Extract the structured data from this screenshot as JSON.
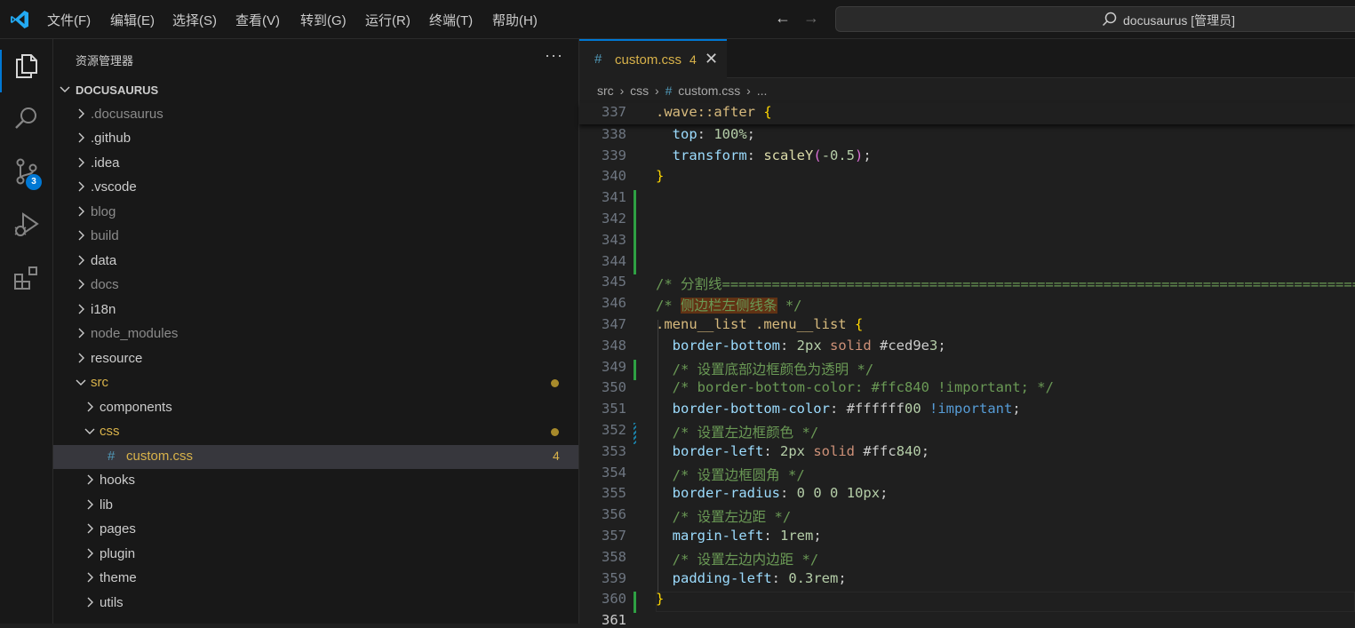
{
  "titlebar": {
    "menus": [
      "文件(F)",
      "编辑(E)",
      "选择(S)",
      "查看(V)",
      "转到(G)",
      "运行(R)",
      "终端(T)",
      "帮助(H)"
    ],
    "command_center": "docusaurus [管理员]"
  },
  "activity_bar": {
    "icons": [
      "files-icon",
      "search-icon",
      "source-control-icon",
      "run-debug-icon",
      "extensions-icon"
    ],
    "scm_badge": "3"
  },
  "sidebar": {
    "title": "资源管理器",
    "more": "···",
    "root": "DOCUSAURUS",
    "items": [
      {
        "label": ".docusaurus",
        "dim": true
      },
      {
        "label": ".github"
      },
      {
        "label": ".idea"
      },
      {
        "label": ".vscode"
      },
      {
        "label": "blog",
        "dim": true
      },
      {
        "label": "build",
        "dim": true
      },
      {
        "label": "data"
      },
      {
        "label": "docs",
        "dim": true
      },
      {
        "label": "i18n"
      },
      {
        "label": "node_modules",
        "dim": true
      },
      {
        "label": "resource"
      },
      {
        "label": "src",
        "open": true,
        "modified": true
      },
      {
        "label": "components",
        "depth": 2
      },
      {
        "label": "css",
        "depth": 2,
        "open": true,
        "modified": true
      },
      {
        "label": "custom.css",
        "depth": 3,
        "file": true,
        "selected": true,
        "count": "4"
      },
      {
        "label": "hooks",
        "depth": 2
      },
      {
        "label": "lib",
        "depth": 2
      },
      {
        "label": "pages",
        "depth": 2
      },
      {
        "label": "plugin",
        "depth": 2
      },
      {
        "label": "theme",
        "depth": 2
      },
      {
        "label": "utils",
        "depth": 2
      }
    ]
  },
  "editor": {
    "tab": {
      "name": "custom.css",
      "problems": "4",
      "close": "✕"
    },
    "breadcrumb": [
      "src",
      "css",
      "custom.css",
      "..."
    ],
    "sticky": {
      "line": "337",
      "text": ".wave::after {"
    },
    "lines": [
      {
        "n": "338",
        "text": "  top: 100%;"
      },
      {
        "n": "339",
        "text": "  transform: scaleY(-0.5);"
      },
      {
        "n": "340",
        "text": "}"
      },
      {
        "n": "341",
        "text": ""
      },
      {
        "n": "342",
        "text": ""
      },
      {
        "n": "343",
        "text": ""
      },
      {
        "n": "344",
        "text": ""
      },
      {
        "n": "345",
        "text": "/* 分割线=================================================================================="
      },
      {
        "n": "346",
        "text": "/* 侧边栏左侧线条 */"
      },
      {
        "n": "347",
        "text": ".menu__list .menu__list {"
      },
      {
        "n": "348",
        "text": "  border-bottom: 2px solid #ced9e3;"
      },
      {
        "n": "349",
        "text": "  /* 设置底部边框颜色为透明 */"
      },
      {
        "n": "350",
        "text": "  /* border-bottom-color: #ffc840 !important; */"
      },
      {
        "n": "351",
        "text": "  border-bottom-color: #ffffff00 !important;"
      },
      {
        "n": "352",
        "text": "  /* 设置左边框颜色 */"
      },
      {
        "n": "353",
        "text": "  border-left: 2px solid #ffc840;"
      },
      {
        "n": "354",
        "text": "  /* 设置边框圆角 */"
      },
      {
        "n": "355",
        "text": "  border-radius: 0 0 0 10px;"
      },
      {
        "n": "356",
        "text": "  /* 设置左边距 */"
      },
      {
        "n": "357",
        "text": "  margin-left: 1rem;"
      },
      {
        "n": "358",
        "text": "  /* 设置左边内边距 */"
      },
      {
        "n": "359",
        "text": "  padding-left: 0.3rem;"
      },
      {
        "n": "360",
        "text": "}"
      },
      {
        "n": "361",
        "text": ""
      }
    ],
    "colors": {
      "swatch1": "#ced9e3",
      "swatch2": "#ffffff00",
      "swatch3": "#ffc840"
    }
  }
}
